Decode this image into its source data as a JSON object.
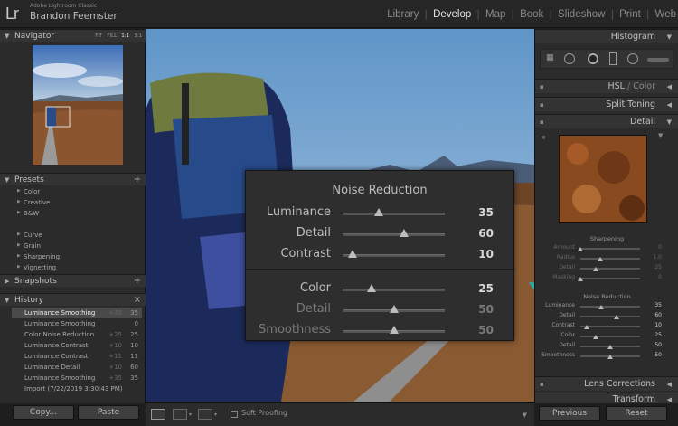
{
  "header": {
    "logo": "Lr",
    "app_name": "Adobe Lightroom Classic",
    "user_name": "Brandon Feemster",
    "modules": [
      "Library",
      "Develop",
      "Map",
      "Book",
      "Slideshow",
      "Print",
      "Web"
    ],
    "active_module": "Develop"
  },
  "left_panel": {
    "navigator": {
      "title": "Navigator",
      "zoom_options": [
        "FIT",
        "FILL",
        "1:1",
        "3:1"
      ]
    },
    "presets": {
      "title": "Presets",
      "groups_a": [
        "Color",
        "Creative",
        "B&W"
      ],
      "groups_b": [
        "Curve",
        "Grain",
        "Sharpening",
        "Vignetting"
      ]
    },
    "snapshots": {
      "title": "Snapshots"
    },
    "history": {
      "title": "History",
      "items": [
        {
          "label": "Luminance Smoothing",
          "a": "+35",
          "b": "35"
        },
        {
          "label": "Luminance Smoothing",
          "a": "",
          "b": "0"
        },
        {
          "label": "Color Noise Reduction",
          "a": "+25",
          "b": "25"
        },
        {
          "label": "Luminance Contrast",
          "a": "+10",
          "b": "10"
        },
        {
          "label": "Luminance Contrast",
          "a": "+11",
          "b": "11"
        },
        {
          "label": "Luminance Detail",
          "a": "+10",
          "b": "60"
        },
        {
          "label": "Luminance Smoothing",
          "a": "+35",
          "b": "35"
        },
        {
          "label": "Import (7/22/2019 3:30:43 PM)",
          "a": "",
          "b": ""
        }
      ]
    },
    "copy_label": "Copy...",
    "paste_label": "Paste"
  },
  "toolbar": {
    "soft_proofing": "Soft Proofing"
  },
  "noise_reduction_overlay": {
    "title": "Noise Reduction",
    "luminance_sliders": [
      {
        "label": "Luminance",
        "value": "35",
        "pos": 0.35
      },
      {
        "label": "Detail",
        "value": "60",
        "pos": 0.6
      },
      {
        "label": "Contrast",
        "value": "10",
        "pos": 0.1
      }
    ],
    "color_sliders": [
      {
        "label": "Color",
        "value": "25",
        "pos": 0.28
      },
      {
        "label": "Detail",
        "value": "50",
        "pos": 0.5
      },
      {
        "label": "Smoothness",
        "value": "50",
        "pos": 0.5
      }
    ]
  },
  "right_panel": {
    "histogram": "Histogram",
    "hsl": "HSL",
    "hsl_color": "Color",
    "split_toning": "Split Toning",
    "detail": "Detail",
    "sharpening": {
      "title": "Sharpening",
      "rows": [
        {
          "label": "Amount",
          "value": "0",
          "pos": 0.0
        },
        {
          "label": "Radius",
          "value": "1.0",
          "pos": 0.33
        },
        {
          "label": "Detail",
          "value": "25",
          "pos": 0.25
        },
        {
          "label": "Masking",
          "value": "0",
          "pos": 0.0
        }
      ]
    },
    "noise_reduction": {
      "title": "Noise Reduction",
      "rows": [
        {
          "label": "Luminance",
          "value": "35",
          "pos": 0.35
        },
        {
          "label": "Detail",
          "value": "60",
          "pos": 0.6
        },
        {
          "label": "Contrast",
          "value": "10",
          "pos": 0.1
        },
        {
          "label": "Color",
          "value": "25",
          "pos": 0.25
        },
        {
          "label": "Detail",
          "value": "50",
          "pos": 0.5
        },
        {
          "label": "Smoothness",
          "value": "50",
          "pos": 0.5
        }
      ]
    },
    "lens_corrections": "Lens Corrections",
    "transform": "Transform",
    "previous_label": "Previous",
    "reset_label": "Reset"
  },
  "colors": {
    "annotation_arrow": "#1fb5a8"
  }
}
